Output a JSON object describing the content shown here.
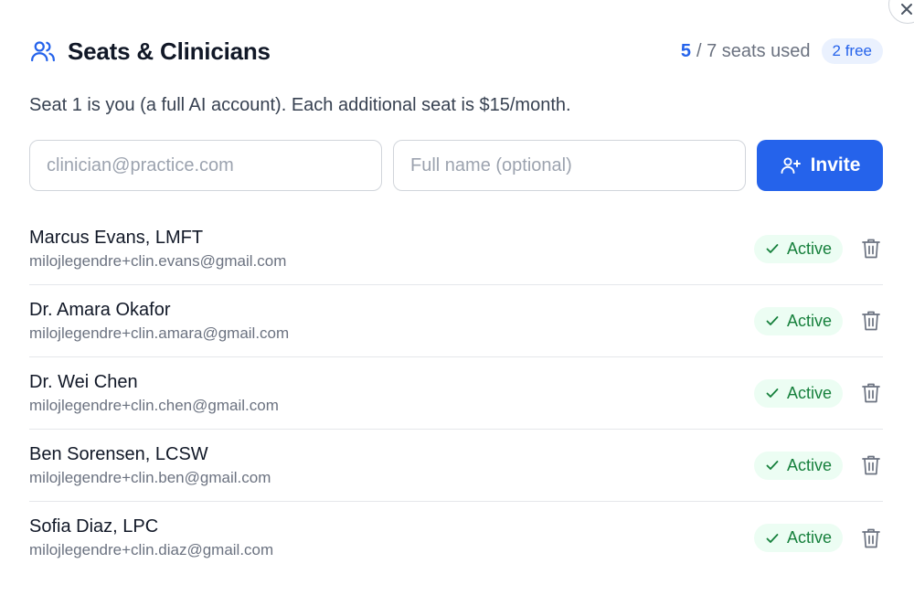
{
  "header": {
    "title": "Seats & Clinicians",
    "seats_used": "5",
    "seats_total": "/ 7 seats used",
    "free_badge": "2 free"
  },
  "description": "Seat 1 is you (a full AI account). Each additional seat is $15/month.",
  "invite": {
    "email_placeholder": "clinician@practice.com",
    "name_placeholder": "Full name (optional)",
    "button_label": "Invite"
  },
  "clinicians": [
    {
      "name": "Marcus Evans, LMFT",
      "email": "milojlegendre+clin.evans@gmail.com",
      "status": "Active"
    },
    {
      "name": "Dr. Amara Okafor",
      "email": "milojlegendre+clin.amara@gmail.com",
      "status": "Active"
    },
    {
      "name": "Dr. Wei Chen",
      "email": "milojlegendre+clin.chen@gmail.com",
      "status": "Active"
    },
    {
      "name": "Ben Sorensen, LCSW",
      "email": "milojlegendre+clin.ben@gmail.com",
      "status": "Active"
    },
    {
      "name": "Sofia Diaz, LPC",
      "email": "milojlegendre+clin.diaz@gmail.com",
      "status": "Active"
    }
  ],
  "icons": {
    "title": "users-icon",
    "invite": "user-plus-icon",
    "status": "check-icon",
    "delete": "trash-icon",
    "close": "close-icon"
  },
  "colors": {
    "accent": "#2563eb",
    "active_text": "#16803c",
    "active_bg": "#ecfdf3"
  }
}
